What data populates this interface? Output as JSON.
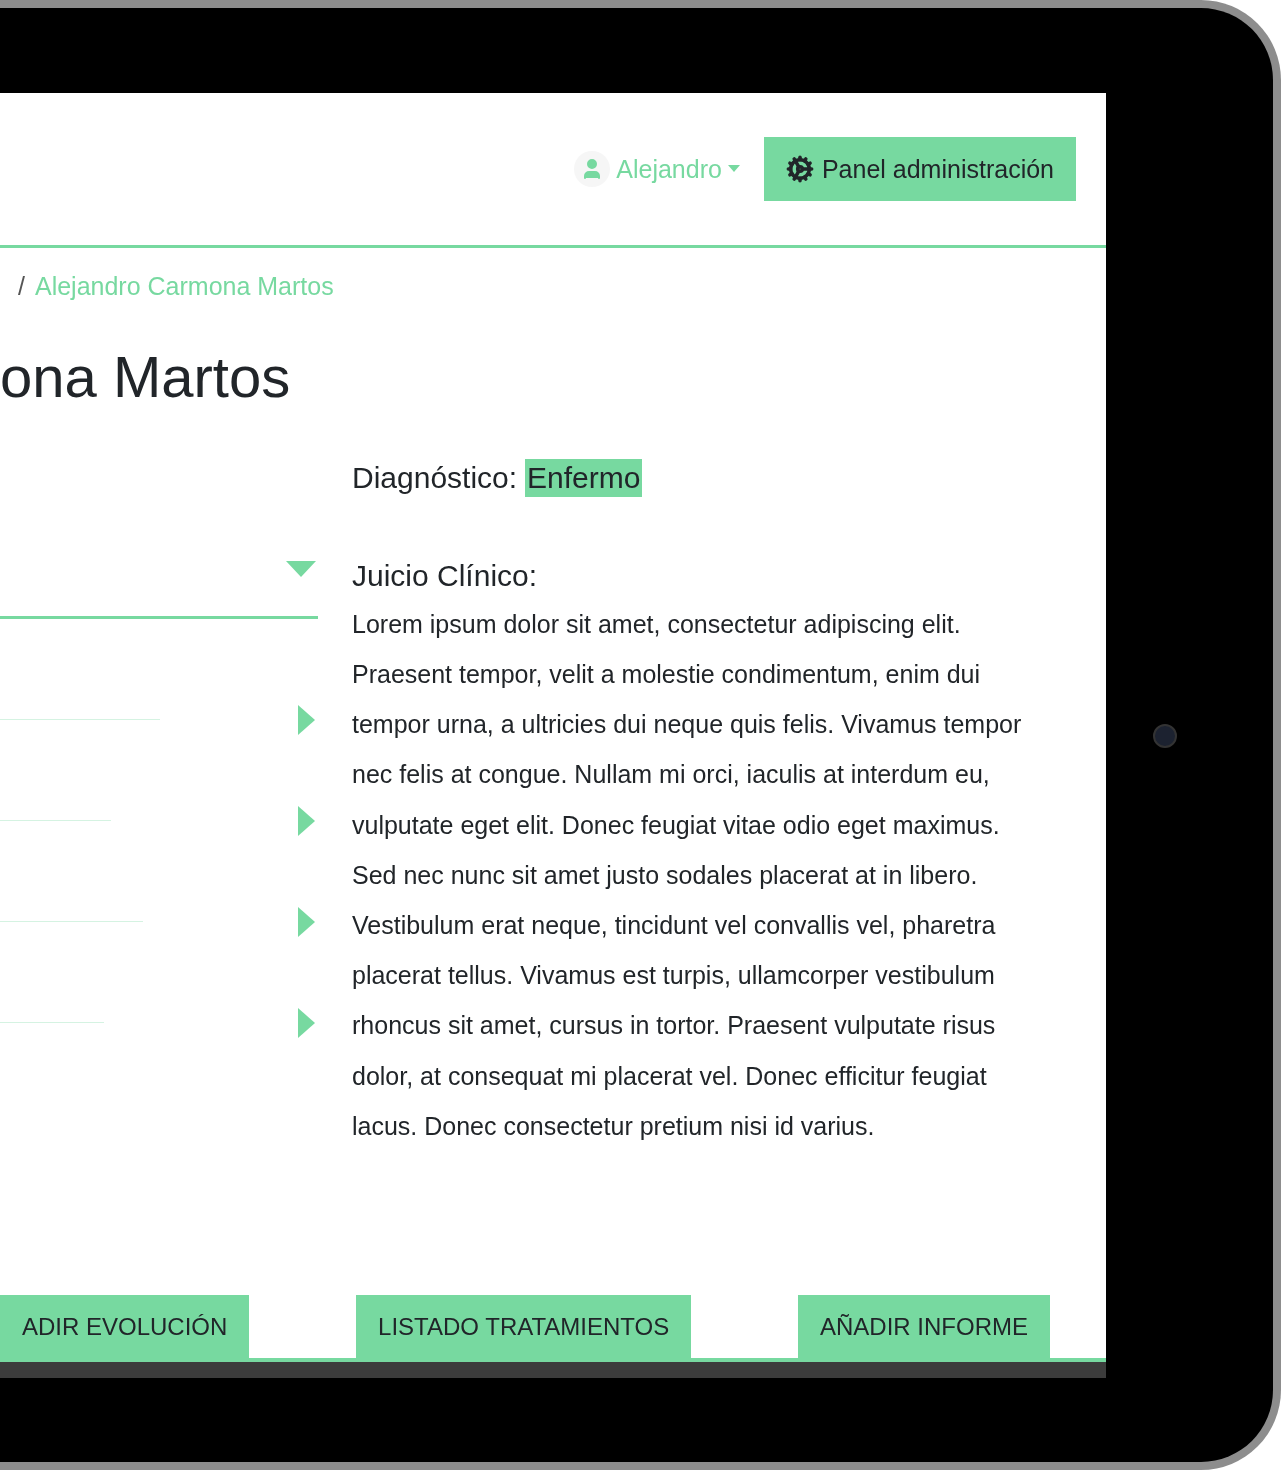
{
  "header": {
    "user_menu": {
      "label": "Alejandro"
    },
    "admin_button": {
      "label": "Panel administración"
    }
  },
  "breadcrumb": {
    "separator": "/",
    "current": "Alejandro Carmona Martos"
  },
  "page_title": "ona Martos",
  "accordion": [
    {
      "expanded": true
    },
    {
      "expanded": false
    },
    {
      "expanded": false
    },
    {
      "expanded": false
    },
    {
      "expanded": false
    }
  ],
  "diagnosis": {
    "label": "Diagnóstico:",
    "value": "Enfermo"
  },
  "clinical_judgement": {
    "label": "Juicio Clínico:",
    "text": "Lorem ipsum dolor sit amet, consectetur adipiscing elit. Praesent tempor, velit a molestie condimentum, enim dui tempor urna, a ultricies dui neque quis felis. Vivamus tempor nec felis at congue. Nullam mi orci, iaculis at interdum eu, vulputate eget elit. Donec feugiat vitae odio eget maximus. Sed nec nunc sit amet justo sodales placerat at in libero. Vestibulum erat neque, tincidunt vel convallis vel, pharetra placerat tellus. Vivamus est turpis, ullamcorper vestibulum rhoncus sit amet, cursus in tortor. Praesent vulputate risus dolor, at consequat mi placerat vel. Donec efficitur feugiat lacus. Donec consectetur pretium nisi id varius."
  },
  "actions": [
    {
      "label": "ADIR EVOLUCIÓN"
    },
    {
      "label": "LISTADO TRATAMIENTOS"
    },
    {
      "label": "AÑADIR INFORME"
    }
  ]
}
